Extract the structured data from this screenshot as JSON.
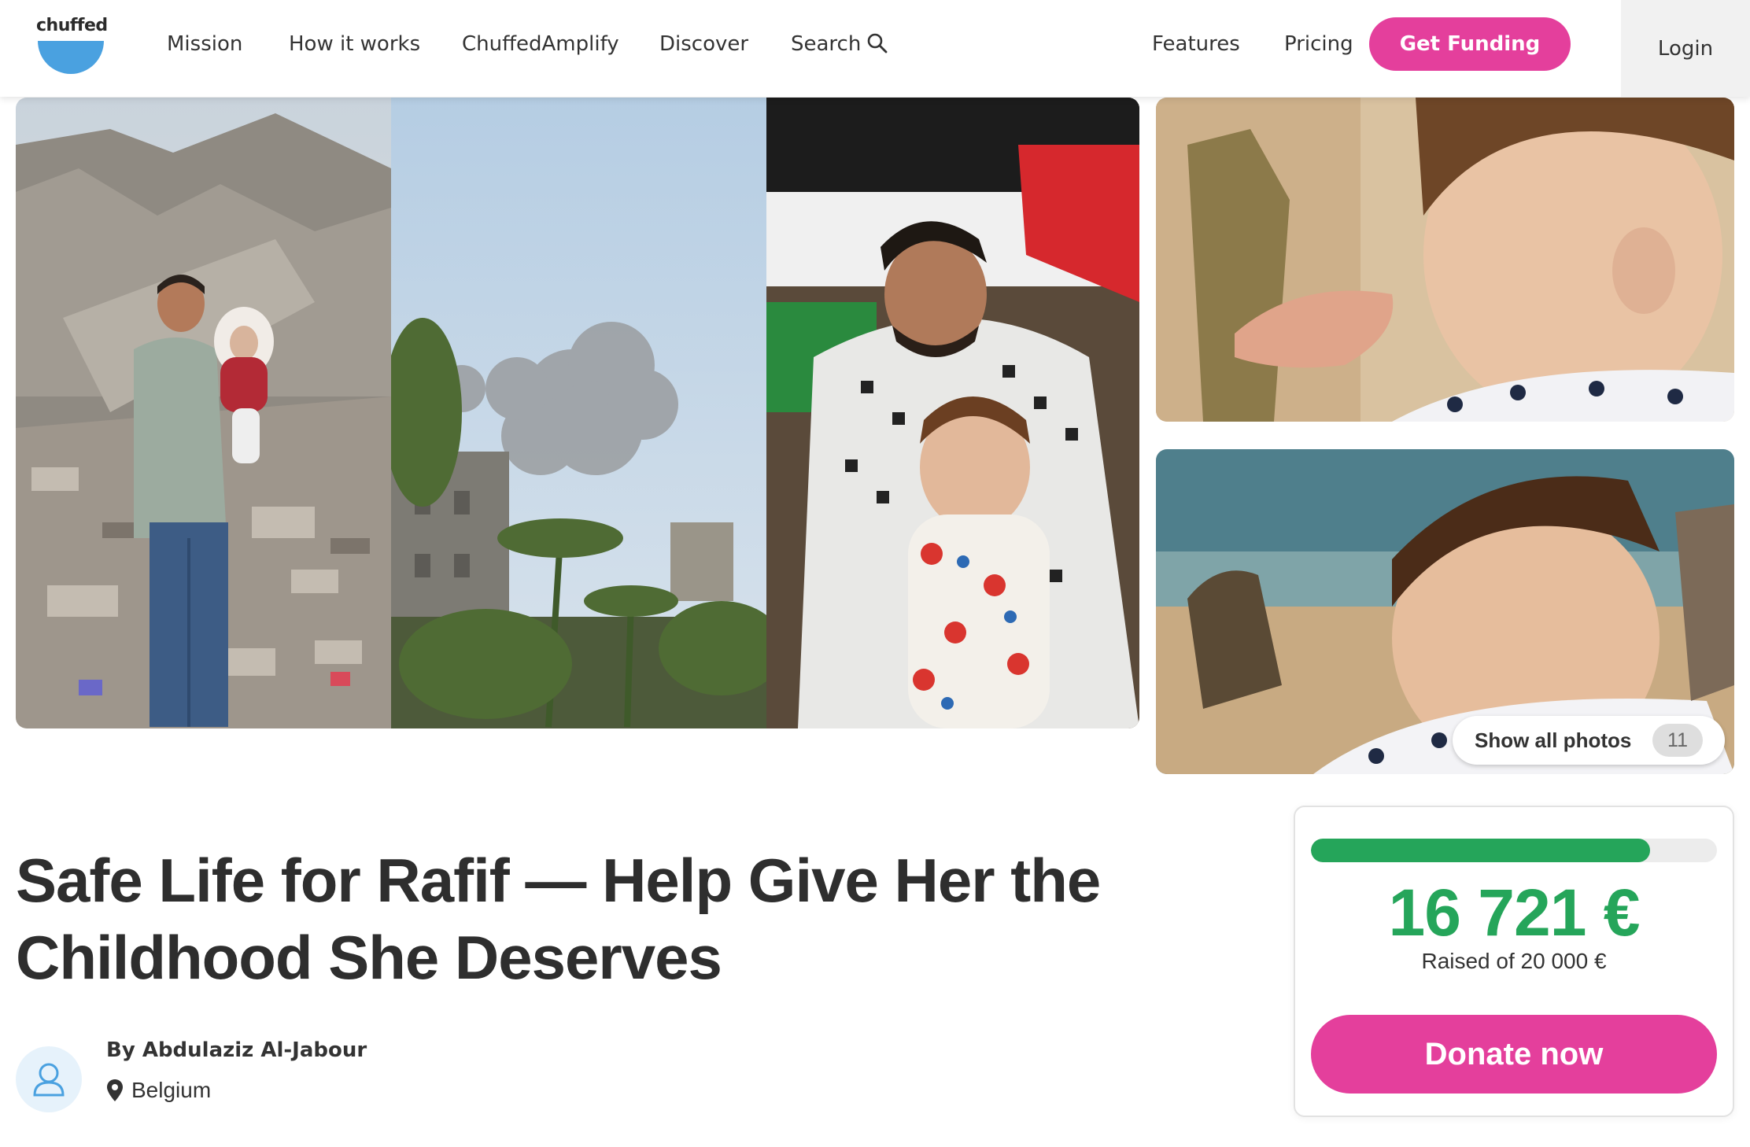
{
  "nav": {
    "logo_text": "chuffed",
    "links": {
      "mission": "Mission",
      "how_it_works": "How it works",
      "amplify": "ChuffedAmplify",
      "discover": "Discover",
      "search": "Search",
      "features": "Features",
      "pricing": "Pricing"
    },
    "get_funding": "Get Funding",
    "login": "Login",
    "search_icon": "search-icon"
  },
  "gallery": {
    "show_all_label": "Show all photos",
    "photo_count": "11"
  },
  "campaign": {
    "title": "Safe Life for Rafif — Help Give Her the Childhood She Deserves",
    "author": "By Abdulaziz Al-Jabour",
    "location": "Belgium",
    "location_icon": "map-pin-icon",
    "avatar_icon": "user-icon"
  },
  "donation": {
    "amount": "16 721 €",
    "raised_text": "Raised of 20 000 €",
    "progress_fraction": 0.836,
    "donate_label": "Donate now"
  },
  "colors": {
    "accent_pink": "#e43f9c",
    "progress_green": "#25a55a",
    "logo_blue": "#4aa1e0"
  }
}
